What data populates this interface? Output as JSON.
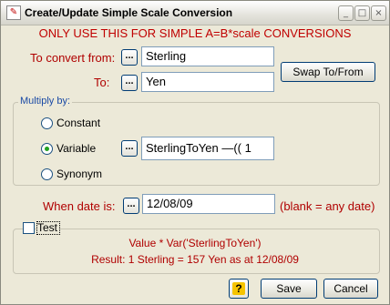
{
  "window": {
    "title": "Create/Update Simple Scale Conversion",
    "minimize_glyph": "_",
    "maximize_glyph": "□",
    "close_glyph": "×"
  },
  "warning": "ONLY USE THIS FOR SIMPLE A=B*scale CONVERSIONS",
  "convert_from": {
    "label": "To convert from:",
    "value": "Sterling",
    "browse_label": "..."
  },
  "convert_to": {
    "label": "To:",
    "value": "Yen",
    "browse_label": "..."
  },
  "swap_button": "Swap To/From",
  "multiply": {
    "legend": "Multiply by:",
    "options": [
      {
        "label": "Constant",
        "selected": false
      },
      {
        "label": "Variable",
        "selected": true
      },
      {
        "label": "Synonym",
        "selected": false
      }
    ],
    "variable_browse_label": "...",
    "variable_value": "SterlingToYen     —(( 1"
  },
  "date": {
    "label": "When date is:",
    "browse_label": "...",
    "value": "12/08/09",
    "hint": "(blank = any date)"
  },
  "test": {
    "label": "Test",
    "checked": false,
    "formula": "Value * Var('SterlingToYen')",
    "result": "Result: 1 Sterling = 157 Yen as at 12/08/09"
  },
  "footer": {
    "help_glyph": "?",
    "save_label": "Save",
    "cancel_label": "Cancel"
  },
  "colors": {
    "label_red": "#b00000",
    "accent_blue": "#1a4aa5",
    "dialog_bg": "#ece9d8"
  }
}
